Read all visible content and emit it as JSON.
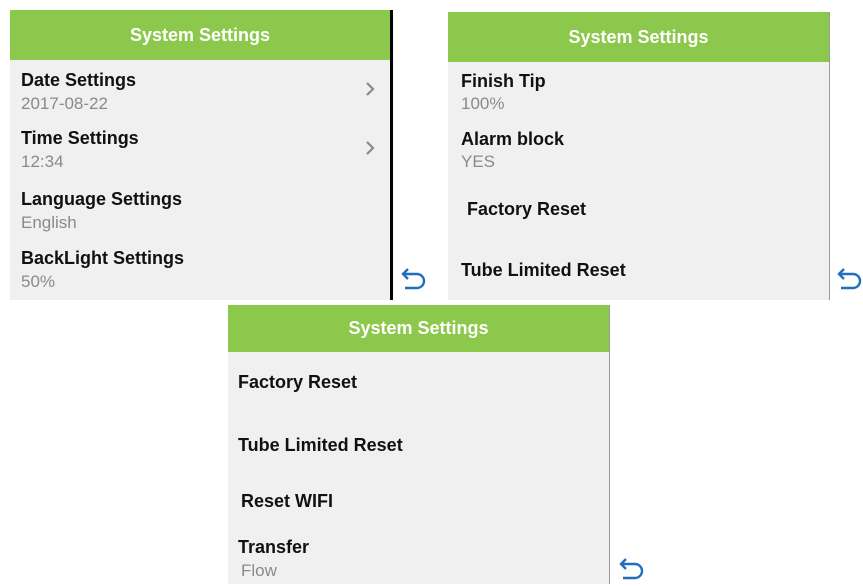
{
  "colors": {
    "header": "#8cc84b",
    "panel_bg": "#f0f0f0",
    "title": "#111111",
    "value": "#8a8a8a",
    "back_icon": "#1e6fc0"
  },
  "panel1": {
    "title": "System Settings",
    "items": [
      {
        "label": "Date Settings",
        "value": "2017-08-22",
        "icon": "chevron-right-icon"
      },
      {
        "label": "Time Settings",
        "value": "12:34",
        "icon": "chevron-right-icon"
      },
      {
        "label": "Language Settings",
        "value": "English"
      },
      {
        "label": "BackLight Settings",
        "value": "50%"
      }
    ],
    "back_icon": "back-arrow-icon"
  },
  "panel2": {
    "title": "System Settings",
    "items": [
      {
        "label": "Finish Tip",
        "value": "100%"
      },
      {
        "label": "Alarm block",
        "value": "YES"
      },
      {
        "label": "Factory Reset"
      },
      {
        "label": "Tube Limited Reset"
      }
    ],
    "back_icon": "back-arrow-icon"
  },
  "panel3": {
    "title": "System Settings",
    "items": [
      {
        "label": "Factory Reset"
      },
      {
        "label": "Tube Limited Reset"
      },
      {
        "label": "Reset WIFI"
      },
      {
        "label": "Transfer",
        "value": "Flow"
      }
    ],
    "back_icon": "back-arrow-icon"
  }
}
